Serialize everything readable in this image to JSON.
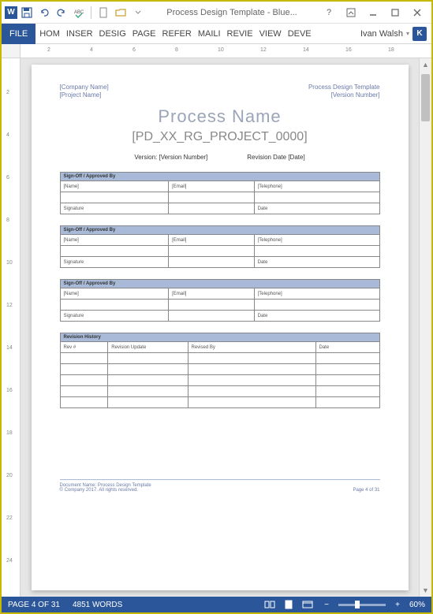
{
  "titlebar": {
    "title": "Process Design Template - Blue..."
  },
  "ribbon": {
    "file": "FILE",
    "tabs": [
      "HOM",
      "INSER",
      "DESIG",
      "PAGE",
      "REFER",
      "MAILI",
      "REVIE",
      "VIEW",
      "DEVE"
    ]
  },
  "user": {
    "name": "Ivan Walsh",
    "initial": "K"
  },
  "ruler_h": [
    "2",
    "4",
    "6",
    "8",
    "10",
    "12",
    "14",
    "16",
    "18"
  ],
  "ruler_v": [
    "2",
    "4",
    "6",
    "8",
    "10",
    "12",
    "14",
    "16",
    "18",
    "20",
    "22",
    "24"
  ],
  "page": {
    "head_left": [
      "[Company Name]",
      "[Project Name]"
    ],
    "head_right": [
      "Process Design Template",
      "[Version Number]"
    ],
    "title": "Process Name",
    "code": "[PD_XX_RG_PROJECT_0000]",
    "meta_version_label": "Version:",
    "meta_version_value": "[Version Number]",
    "meta_revdate_label": "Revision Date",
    "meta_revdate_value": "[Date]",
    "signoff_header": "Sign-Off / Approved By",
    "signoff_cols": [
      "[Name]",
      "[Email]",
      "[Telephone]"
    ],
    "signoff_row2": [
      "Signature",
      "",
      "Date"
    ],
    "revhist_header": "Revision History",
    "revhist_cols": [
      "Rev #",
      "Revision Update",
      "Revised By",
      "Date"
    ],
    "footer_doc": "Document Name: Process Design Template",
    "footer_copy": "© Company 2017. All rights reserved.",
    "footer_page": "Page 4 of 31"
  },
  "status": {
    "page": "PAGE 4 OF 31",
    "words": "4851 WORDS",
    "zoom": "60%"
  }
}
